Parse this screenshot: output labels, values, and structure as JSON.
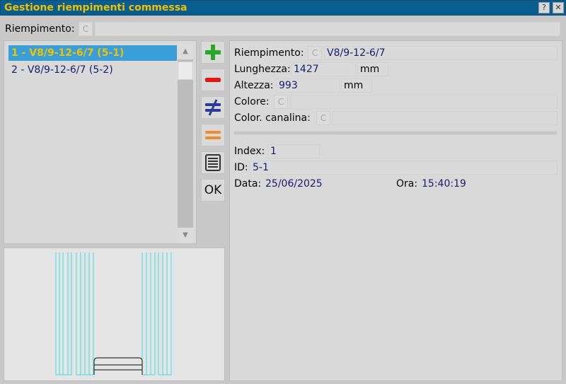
{
  "window": {
    "title": "Gestione riempimenti commessa",
    "help_label": "?",
    "close_label": "✕"
  },
  "top": {
    "label": "Riempimento:",
    "c_label": "C",
    "value": ""
  },
  "list": {
    "items": [
      {
        "label": "1 - V8/9-12-6/7 (5-1)"
      },
      {
        "label": "2 - V8/9-12-6/7 (5-2)"
      }
    ],
    "scroll_up": "▲",
    "scroll_down": "▼"
  },
  "toolbar": {
    "ok_label": "OK"
  },
  "details": {
    "riempimento_label": "Riempimento:",
    "riempimento_c": "C",
    "riempimento_value": "V8/9-12-6/7",
    "lunghezza_label": "Lunghezza:",
    "lunghezza_value": "1427",
    "lunghezza_unit": "mm",
    "altezza_label": "Altezza:",
    "altezza_value": "993",
    "altezza_unit": "mm",
    "colore_label": "Colore:",
    "colore_c": "C",
    "colore_value": "",
    "canalina_label": "Color. canalina:",
    "canalina_c": "C",
    "canalina_value": "",
    "index_label": "Index:",
    "index_value": "1",
    "id_label": "ID:",
    "id_value": "5-1",
    "data_label": "Data:",
    "data_value": "25/06/2025",
    "ora_label": "Ora:",
    "ora_value": "15:40:19"
  },
  "colors": {
    "titlebar": "#0a5d8f",
    "title_text": "#f0c000",
    "selection": "#3a9fd8",
    "value_text": "#1a1a6a",
    "preview_lines": "#3ee0e8"
  }
}
